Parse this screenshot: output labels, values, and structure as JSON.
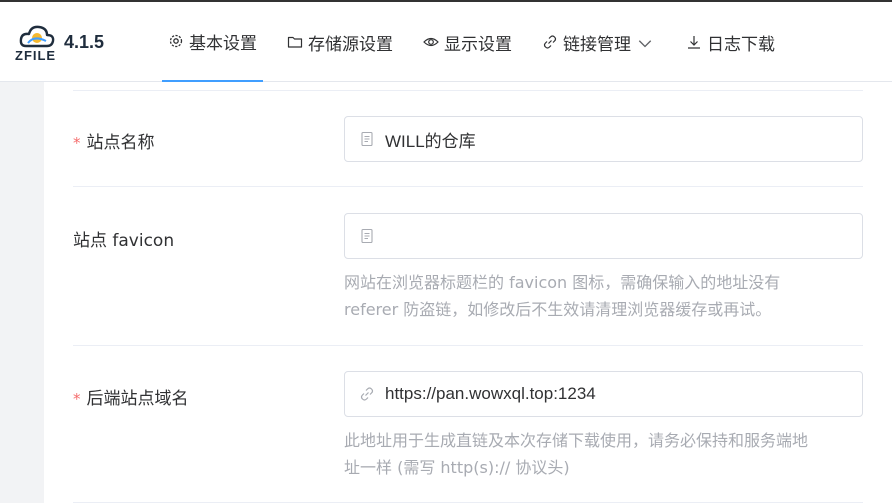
{
  "app": {
    "logo_text": "ZFILE",
    "version": "4.1.5"
  },
  "nav": [
    {
      "label": "基本设置",
      "icon": "gear-icon",
      "active": true
    },
    {
      "label": "存储源设置",
      "icon": "folder-icon"
    },
    {
      "label": "显示设置",
      "icon": "eye-icon"
    },
    {
      "label": "链接管理",
      "icon": "link-icon",
      "dropdown": true
    },
    {
      "label": "日志下载",
      "icon": "download-icon"
    }
  ],
  "form": {
    "site_name": {
      "label": "站点名称",
      "required": true,
      "value": "WILL的仓库"
    },
    "site_favicon": {
      "label": "站点 favicon",
      "value": "",
      "help1": "网站在浏览器标题栏的 favicon 图标，需确保输入的地址没有",
      "help2": "referer 防盗链，如修改后不生效请清理浏览器缓存或再试。"
    },
    "backend_domain": {
      "label": "后端站点域名",
      "required": true,
      "value": "https://pan.wowxql.top:1234",
      "help1": "此地址用于生成直链及本次存储下载使用，请务必保持和服务端地",
      "help2": "址一样 (需写 http(s):// 协议头)"
    }
  },
  "colors": {
    "accent": "#409eff",
    "required": "#f56c6c",
    "help": "#a8abb2"
  }
}
